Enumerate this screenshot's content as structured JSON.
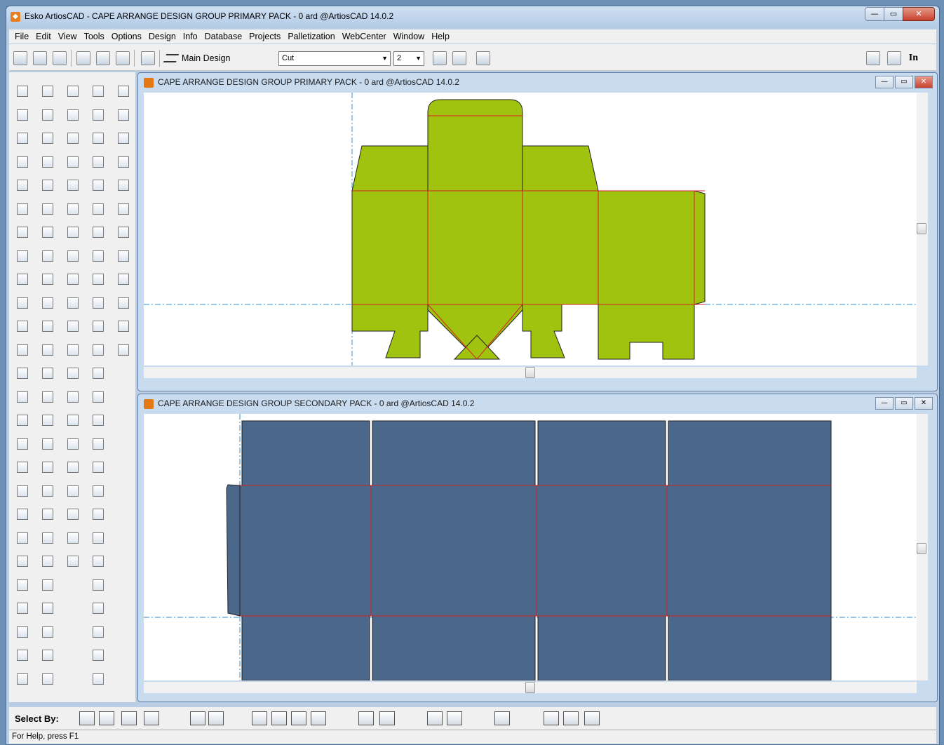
{
  "app": {
    "title": "Esko ArtiosCAD - CAPE ARRANGE DESIGN GROUP PRIMARY PACK - 0 ard @ArtiosCAD 14.0.2",
    "icon": "artioscad-icon"
  },
  "menu": [
    "File",
    "Edit",
    "View",
    "Tools",
    "Options",
    "Design",
    "Info",
    "Database",
    "Projects",
    "Palletization",
    "WebCenter",
    "Window",
    "Help"
  ],
  "toolbar": {
    "main_design_label": "Main Design",
    "layer_select": "Cut",
    "line_number_select": "2",
    "right_label": "In"
  },
  "windows": {
    "primary": {
      "title": "CAPE ARRANGE DESIGN GROUP PRIMARY PACK - 0 ard @ArtiosCAD 14.0.2",
      "fill_color": "#a0c30f"
    },
    "secondary": {
      "title": "CAPE ARRANGE DESIGN GROUP SECONDARY PACK - 0 ard @ArtiosCAD 14.0.2",
      "fill_color": "#4b678a"
    }
  },
  "colors": {
    "crease": "#d62020",
    "guide": "#2a8bd6",
    "outline": "#222222"
  },
  "select_by": {
    "label": "Select By:"
  },
  "status": {
    "help_text": "For Help, press F1"
  }
}
